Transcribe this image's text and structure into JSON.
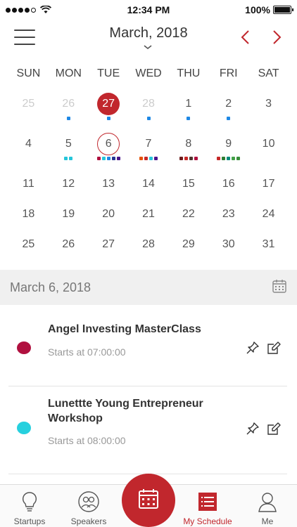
{
  "status_bar": {
    "time": "12:34 PM",
    "battery": "100%"
  },
  "header": {
    "month_title": "March, 2018"
  },
  "weekdays": [
    "SUN",
    "MON",
    "TUE",
    "WED",
    "THU",
    "FRI",
    "SAT"
  ],
  "calendar": {
    "weeks": [
      [
        {
          "d": "25",
          "muted": true,
          "marks": []
        },
        {
          "d": "26",
          "muted": true,
          "marks": [
            "#1e88e5"
          ]
        },
        {
          "d": "27",
          "today": true,
          "marks": [
            "#1e88e5"
          ]
        },
        {
          "d": "28",
          "muted": true,
          "marks": [
            "#1e88e5"
          ]
        },
        {
          "d": "1",
          "marks": [
            "#1e88e5"
          ]
        },
        {
          "d": "2",
          "marks": [
            "#1e88e5"
          ]
        },
        {
          "d": "3",
          "marks": []
        }
      ],
      [
        {
          "d": "4",
          "marks": []
        },
        {
          "d": "5",
          "marks": [
            "#26c6da",
            "#26c6da"
          ]
        },
        {
          "d": "6",
          "selected": true,
          "marks": [
            "#b0103f",
            "#26c6da",
            "#1e88e5",
            "#283593",
            "#4a148c"
          ]
        },
        {
          "d": "7",
          "marks": [
            "#e65100",
            "#c62828",
            "#26c6da",
            "#4a148c"
          ]
        },
        {
          "d": "8",
          "marks": [
            "#6d1b1b",
            "#c62828",
            "#4e342e",
            "#b0103f"
          ]
        },
        {
          "d": "9",
          "marks": [
            "#c62828",
            "#2e7d32",
            "#00897b",
            "#43a047",
            "#388e3c"
          ]
        },
        {
          "d": "10",
          "marks": []
        }
      ],
      [
        {
          "d": "11"
        },
        {
          "d": "12"
        },
        {
          "d": "13"
        },
        {
          "d": "14"
        },
        {
          "d": "15"
        },
        {
          "d": "16"
        },
        {
          "d": "17"
        }
      ],
      [
        {
          "d": "18"
        },
        {
          "d": "19"
        },
        {
          "d": "20"
        },
        {
          "d": "21"
        },
        {
          "d": "22"
        },
        {
          "d": "23"
        },
        {
          "d": "24"
        }
      ],
      [
        {
          "d": "25"
        },
        {
          "d": "26"
        },
        {
          "d": "27"
        },
        {
          "d": "28"
        },
        {
          "d": "29"
        },
        {
          "d": "30"
        },
        {
          "d": "31"
        }
      ]
    ]
  },
  "selected_date": {
    "label": "March 6, 2018"
  },
  "events": [
    {
      "title": "Angel Investing MasterClass",
      "time": "Starts at 07:00:00",
      "color": "#b0103f"
    },
    {
      "title": "Lunettte Young Entrepreneur Workshop",
      "time": "Starts at 08:00:00",
      "color": "#26d0de"
    }
  ],
  "tabs": {
    "startups": "Startups",
    "speakers": "Speakers",
    "my_schedule": "My Schedule",
    "me": "Me"
  },
  "colors": {
    "accent": "#c1272d"
  }
}
